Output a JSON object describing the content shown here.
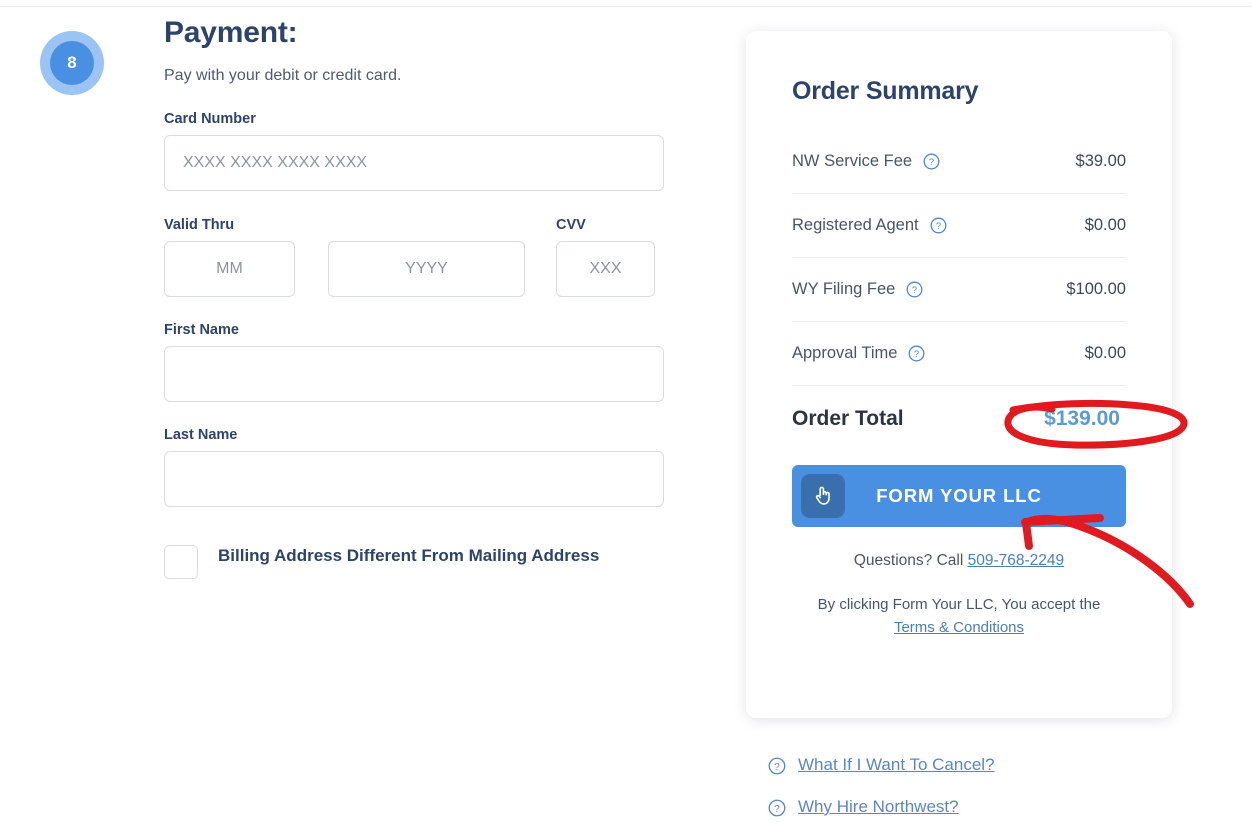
{
  "payment": {
    "step_number": "8",
    "title": "Payment:",
    "subtitle": "Pay with your debit or credit card.",
    "fields": {
      "card_number": {
        "label": "Card Number",
        "placeholder": "XXXX XXXX XXXX XXXX",
        "value": ""
      },
      "valid_thru": {
        "label": "Valid Thru",
        "month_placeholder": "MM",
        "month_value": "",
        "year_placeholder": "YYYY",
        "year_value": ""
      },
      "cvv": {
        "label": "CVV",
        "placeholder": "XXX",
        "value": ""
      },
      "first_name": {
        "label": "First Name",
        "placeholder": "",
        "value": ""
      },
      "last_name": {
        "label": "Last Name",
        "placeholder": "",
        "value": ""
      }
    },
    "billing_checkbox": {
      "label": "Billing Address Different From Mailing Address",
      "checked": false
    }
  },
  "order_summary": {
    "title": "Order Summary",
    "rows": [
      {
        "label": "NW Service Fee",
        "value": "$39.00",
        "help_icon": "question-circle-icon"
      },
      {
        "label": "Registered Agent",
        "value": "$0.00",
        "help_icon": "question-circle-icon"
      },
      {
        "label": "WY Filing Fee",
        "value": "$100.00",
        "help_icon": "question-circle-icon"
      },
      {
        "label": "Approval Time",
        "value": "$0.00",
        "help_icon": "question-circle-icon"
      }
    ],
    "total": {
      "label": "Order Total",
      "value": "$139.00"
    },
    "cta": {
      "label": "FORM YOUR LLC",
      "icon": "pointing-hand-cursor-icon"
    },
    "questions": {
      "text": "Questions? Call ",
      "phone": "509-768-2249"
    },
    "terms": {
      "text": "By clicking Form Your LLC, You accept the",
      "link": "Terms & Conditions"
    }
  },
  "bottom_links": [
    {
      "label": "What If I Want To Cancel?",
      "icon": "question-circle-icon"
    },
    {
      "label": "Why Hire Northwest?",
      "icon": "question-circle-icon"
    }
  ],
  "colors": {
    "accent_blue": "#4a90e2",
    "heading_navy": "#2e4369",
    "link_blue": "#5b86c4",
    "total_blue": "#5b9bd5",
    "annotation_red": "#e01b20",
    "card_bg": "#ffffff",
    "input_border": "#d9dde2"
  },
  "annotations": {
    "total_circle": "red-ellipse-around-order-total",
    "cta_arrow": "red-curved-arrow-to-cta-button"
  }
}
